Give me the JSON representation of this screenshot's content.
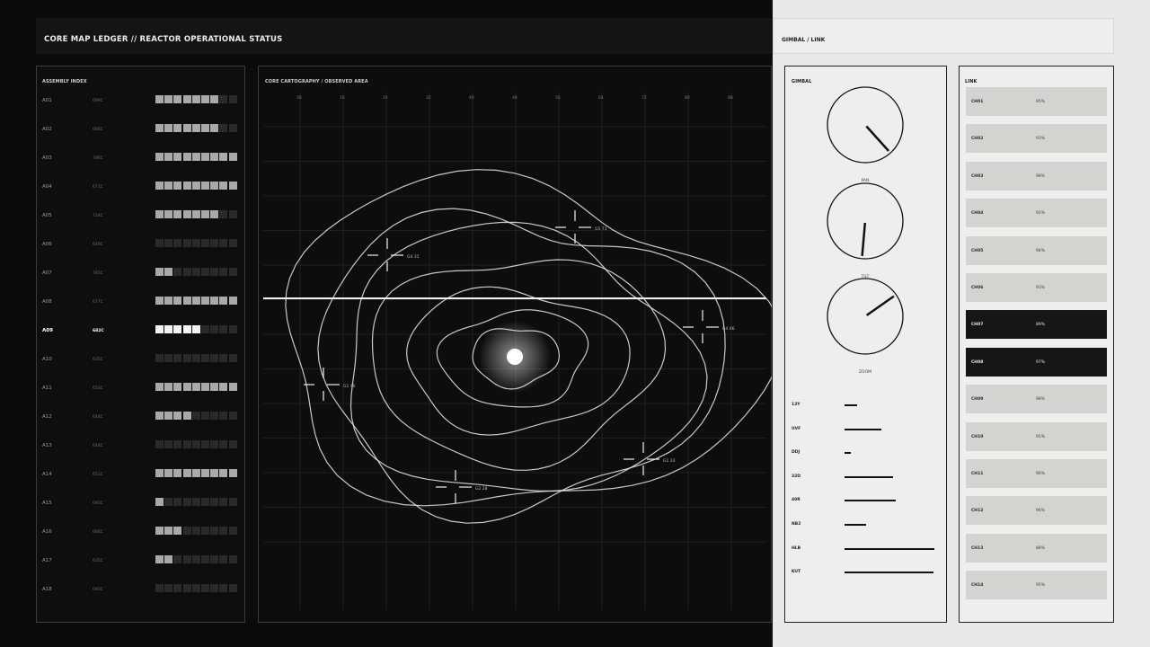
{
  "header": {
    "title": "CORE MAP LEDGER // REACTOR OPERATIONAL STATUS",
    "right_title": "GIMBAL / LINK"
  },
  "assembly": {
    "title": "ASSEMBLY INDEX",
    "segments_total": 9,
    "active_id": "A09",
    "rows": [
      {
        "id": "A01",
        "temp": "699C",
        "level": 7
      },
      {
        "id": "A02",
        "temp": "686C",
        "level": 7
      },
      {
        "id": "A03",
        "temp": "786C",
        "level": 9
      },
      {
        "id": "A04",
        "temp": "671C",
        "level": 9
      },
      {
        "id": "A05",
        "temp": "718C",
        "level": 7
      },
      {
        "id": "A06",
        "temp": "649C",
        "level": 0
      },
      {
        "id": "A07",
        "temp": "785C",
        "level": 2
      },
      {
        "id": "A08",
        "temp": "677C",
        "level": 9
      },
      {
        "id": "A09",
        "temp": "682C",
        "level": 5
      },
      {
        "id": "A10",
        "temp": "635C",
        "level": 0
      },
      {
        "id": "A11",
        "temp": "653C",
        "level": 9
      },
      {
        "id": "A12",
        "temp": "648C",
        "level": 4
      },
      {
        "id": "A13",
        "temp": "648C",
        "level": 0
      },
      {
        "id": "A14",
        "temp": "651C",
        "level": 9
      },
      {
        "id": "A15",
        "temp": "693C",
        "level": 1
      },
      {
        "id": "A16",
        "temp": "686C",
        "level": 3
      },
      {
        "id": "A17",
        "temp": "635C",
        "level": 2
      },
      {
        "id": "A18",
        "temp": "693C",
        "level": 0
      }
    ]
  },
  "map": {
    "title": "CORE CARTOGRAPHY / OBSERVED AREA",
    "x_ticks": [
      "08",
      "16",
      "24",
      "32",
      "40",
      "48",
      "56",
      "64",
      "72",
      "80",
      "88"
    ],
    "markers": [
      {
        "label": "G5 73"
      },
      {
        "label": "G4 31"
      },
      {
        "label": "G4 66"
      },
      {
        "label": "G1 46"
      },
      {
        "label": "G1 33"
      },
      {
        "label": "G2 28"
      }
    ]
  },
  "gimbal": {
    "title": "GIMBAL",
    "dials": [
      {
        "label": "PAN",
        "angle_deg": 138
      },
      {
        "label": "TILT",
        "angle_deg": 185
      },
      {
        "label": "ZOOM",
        "angle_deg": 55
      }
    ],
    "meters": [
      {
        "label": "13Y",
        "value": 0.14
      },
      {
        "label": "UVF",
        "value": 0.41
      },
      {
        "label": "DDJ",
        "value": 0.07
      },
      {
        "label": "32D",
        "value": 0.54
      },
      {
        "label": "40R",
        "value": 0.57
      },
      {
        "label": "NB2",
        "value": 0.24
      },
      {
        "label": "HLB",
        "value": 1.0
      },
      {
        "label": "KUT",
        "value": 0.99
      }
    ]
  },
  "link": {
    "title": "LINK",
    "channels": [
      {
        "name": "CH01",
        "value": "95%",
        "highlight": false
      },
      {
        "name": "CH02",
        "value": "93%",
        "highlight": false
      },
      {
        "name": "CH03",
        "value": "98%",
        "highlight": false
      },
      {
        "name": "CH04",
        "value": "91%",
        "highlight": false
      },
      {
        "name": "CH05",
        "value": "94%",
        "highlight": false
      },
      {
        "name": "CH06",
        "value": "93%",
        "highlight": false
      },
      {
        "name": "CH07",
        "value": "89%",
        "highlight": true
      },
      {
        "name": "CH08",
        "value": "97%",
        "highlight": true
      },
      {
        "name": "CH09",
        "value": "98%",
        "highlight": false
      },
      {
        "name": "CH10",
        "value": "91%",
        "highlight": false
      },
      {
        "name": "CH11",
        "value": "96%",
        "highlight": false
      },
      {
        "name": "CH12",
        "value": "96%",
        "highlight": false
      },
      {
        "name": "CH13",
        "value": "88%",
        "highlight": false
      },
      {
        "name": "CH14",
        "value": "95%",
        "highlight": false
      }
    ]
  },
  "colors": {
    "bg_dark": "#0b0b0b",
    "bg_light": "#e8e9e6",
    "bar_on": "#a9a9a9",
    "bar_active": "#f4f4f4",
    "bar_off": "#2a2a2a",
    "line": "#e6e6e6"
  }
}
